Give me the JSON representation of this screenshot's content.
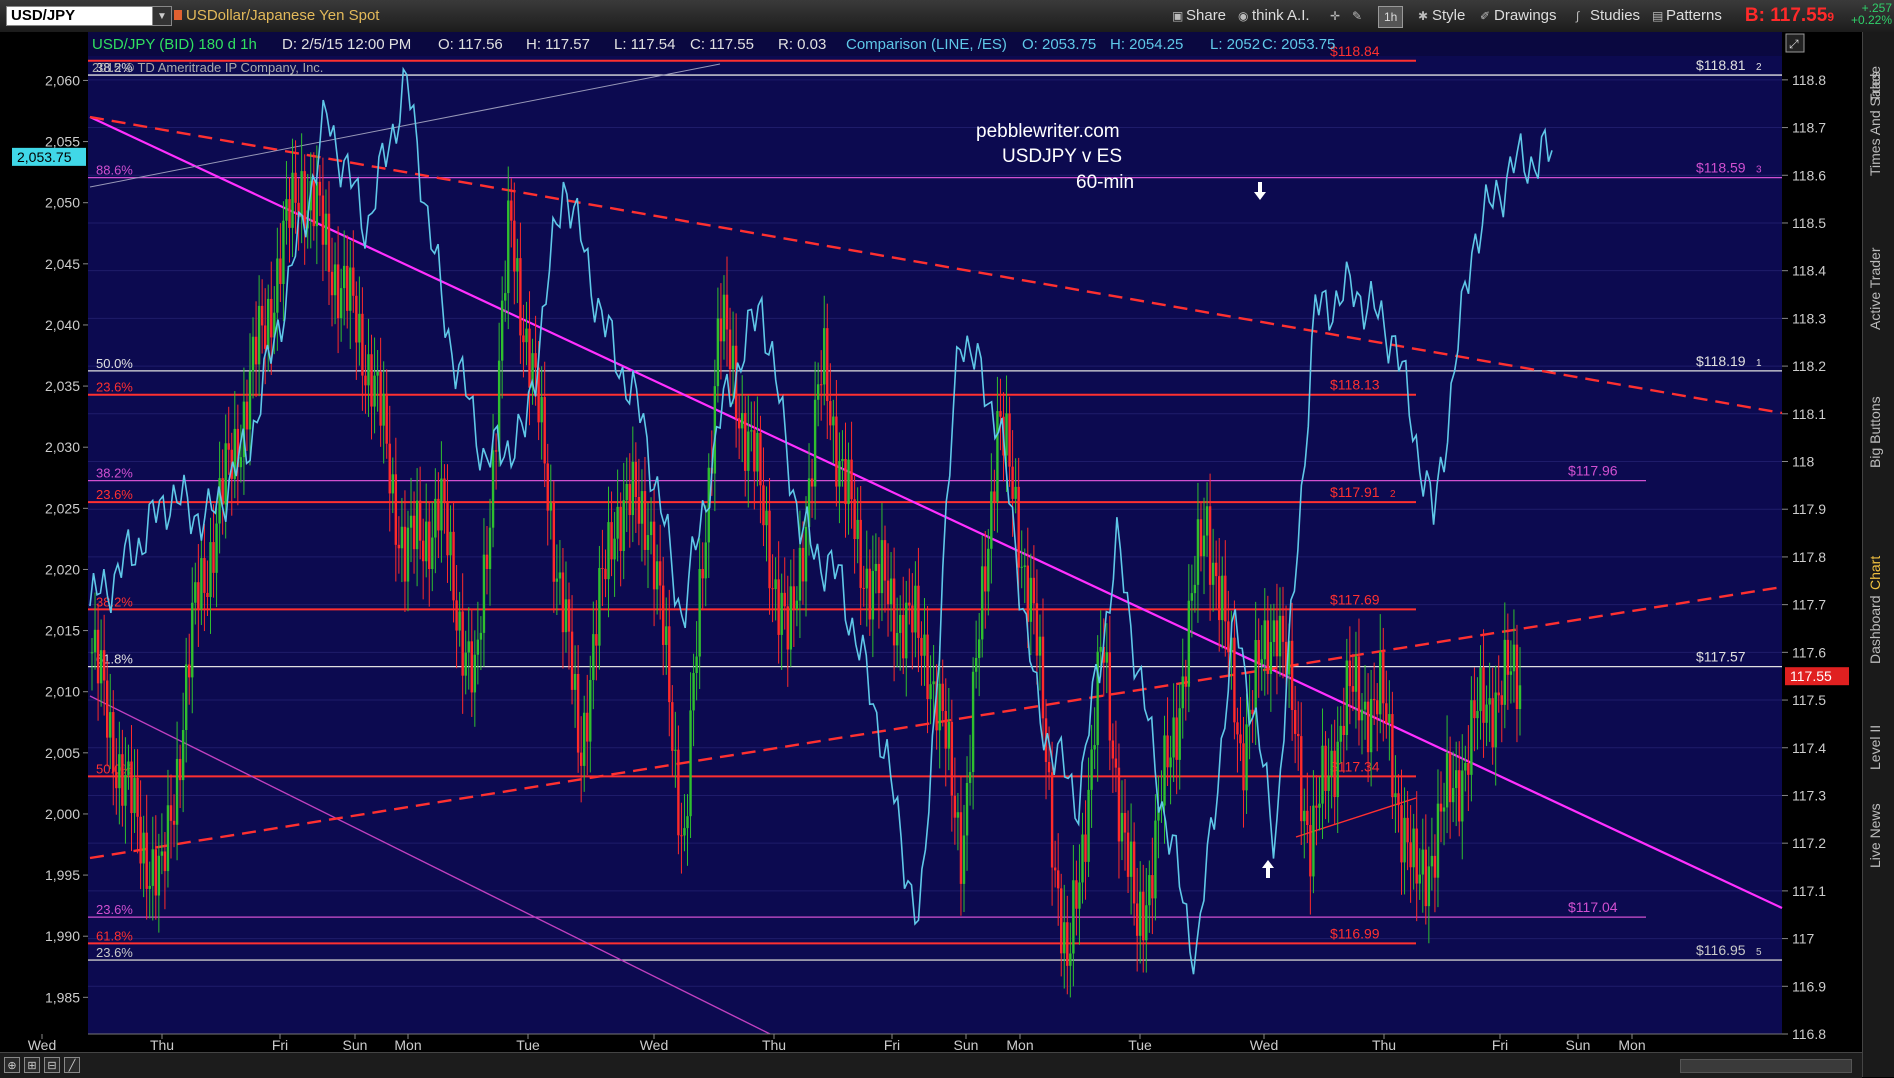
{
  "app": {
    "symbol": "USD/JPY",
    "description": "USDollar/Japanese Yen Spot",
    "toolbar": [
      "Share",
      "think A.I.",
      "1h",
      "Style",
      "Drawings",
      "Studies",
      "Patterns"
    ],
    "bid_label": "B: 117.55",
    "bid_suffix": "9",
    "change_top": "+.257",
    "change_bottom": "+0.22%"
  },
  "side_tabs": [
    "Trade",
    "Times And Sales",
    "Active Trader",
    "Big Buttons",
    "Chart",
    "Dashboard",
    "Level II",
    "Live News"
  ],
  "active_side_tab": "Chart",
  "header_info": {
    "study": "USD/JPY (BID) 180 d 1h",
    "date": "D: 2/5/15 12:00 PM",
    "o": "O: 117.56",
    "h": "H: 117.57",
    "l": "L: 117.54",
    "c": "C: 117.55",
    "r": "R: 0.03",
    "comparison": "Comparison (LINE, /ES)",
    "co": "O: 2053.75",
    "ch": "H: 2054.25",
    "cl": "L: 2052",
    "cc": "C: 2053.75"
  },
  "copyright": "2015 © TD Ameritrade IP Company, Inc.",
  "annotation": [
    "pebblewriter.com",
    "USDJPY v ES",
    "60-min"
  ],
  "chart_data": {
    "type": "line",
    "x_ticks": [
      "Wed",
      "Thu",
      "Fri",
      "Sun",
      "Mon",
      "Tue",
      "Wed",
      "Thu",
      "Fri",
      "Sun",
      "Mon",
      "Tue",
      "Wed",
      "Thu",
      "Fri",
      "Sun",
      "Mon"
    ],
    "right_axis": {
      "ticks": [
        "118.8",
        "118.7",
        "118.6",
        "118.5",
        "118.4",
        "118.3",
        "118.2",
        "118.1",
        "118",
        "117.9",
        "117.8",
        "117.7",
        "117.6",
        "117.5",
        "117.4",
        "117.3",
        "117.2",
        "117.1",
        "117",
        "116.9",
        "116.8"
      ],
      "range": [
        116.8,
        118.85
      ]
    },
    "left_axis": {
      "ticks": [
        "2,060",
        "2,055",
        "2,050",
        "2,045",
        "2,040",
        "2,035",
        "2,030",
        "2,025",
        "2,020",
        "2,015",
        "2,010",
        "2,005",
        "2,000",
        "1,995",
        "1,990",
        "1,985"
      ],
      "range": [
        1982,
        2062
      ]
    },
    "series": [
      {
        "name": "USD/JPY",
        "style": "candles",
        "color_up": "#2fbf2f",
        "color_down": "#ff2a2a",
        "values": [
          117.6,
          117.3,
          117.1,
          117.7,
          118.0,
          118.3,
          118.6,
          118.4,
          118.2,
          117.8,
          117.9,
          117.5,
          118.5,
          118.0,
          117.4,
          117.9,
          117.9,
          117.2,
          118.3,
          118.0,
          117.6,
          118.2,
          117.8,
          117.7,
          117.6,
          117.2,
          118.1,
          117.7,
          116.9,
          117.6,
          117.0,
          117.4,
          117.9,
          117.4,
          117.7,
          117.2,
          117.5,
          117.5,
          117.1,
          117.3,
          117.5,
          117.55
        ],
        "last": "117.55"
      },
      {
        "name": "/ES",
        "style": "line",
        "color": "#5fc8e8",
        "values": [
          2017,
          2021,
          2026,
          2024,
          2030,
          2043,
          2057,
          2048,
          2060,
          2040,
          2029,
          2031,
          2052,
          2040,
          2032,
          2016,
          2033,
          2042,
          2023,
          2019,
          2007,
          1990,
          2040,
          2032,
          2008,
          2001,
          2022,
          2003,
          1988,
          2016,
          1998,
          2041,
          2043,
          2039,
          2024,
          2047,
          2053,
          2054
        ],
        "last": "2,053.75"
      }
    ],
    "levels": [
      {
        "label_left": "38.2%",
        "label_right": "$118.81",
        "label_right_suffix": "2",
        "value": 118.81,
        "color": "#e0e0e0"
      },
      {
        "label_left": "",
        "label_right": "$118.84",
        "label_right_suffix": "",
        "value": 118.84,
        "color": "#ff3030"
      },
      {
        "label_left": "88.6%",
        "label_right": "$118.59",
        "label_right_suffix": "3",
        "value": 118.595,
        "color": "#d050d0"
      },
      {
        "label_left": "50.0%",
        "label_right": "$118.19",
        "label_right_suffix": "1",
        "value": 118.19,
        "color": "#e0e0e0"
      },
      {
        "label_left": "23.6%",
        "label_right": "$118.13",
        "label_right_suffix": "",
        "value": 118.14,
        "color": "#ff3030"
      },
      {
        "label_left": "38.2%",
        "label_right": "$117.96",
        "label_right_suffix": "",
        "value": 117.96,
        "color": "#d050d0"
      },
      {
        "label_left": "23.6%",
        "label_right": "$117.91",
        "label_right_suffix": "2",
        "value": 117.915,
        "color": "#ff3030"
      },
      {
        "label_left": "38.2%",
        "label_right": "$117.69",
        "label_right_suffix": "",
        "value": 117.69,
        "color": "#ff3030"
      },
      {
        "label_left": "61.8%",
        "label_right": "$117.57",
        "label_right_suffix": "",
        "value": 117.57,
        "color": "#e0e0e0"
      },
      {
        "label_left": "50.0%",
        "label_right": "$117.34",
        "label_right_suffix": "",
        "value": 117.34,
        "color": "#ff3030"
      },
      {
        "label_left": "23.6%",
        "label_right": "$117.04",
        "label_right_suffix": "",
        "value": 117.045,
        "color": "#d050d0"
      },
      {
        "label_left": "61.8%",
        "label_right": "$116.99",
        "label_right_suffix": "",
        "value": 116.99,
        "color": "#ff3030"
      },
      {
        "label_left": "23.6%",
        "label_right": "$116.95",
        "label_right_suffix": "5",
        "value": 116.955,
        "color": "#c8c8c8"
      }
    ],
    "grid": true
  }
}
